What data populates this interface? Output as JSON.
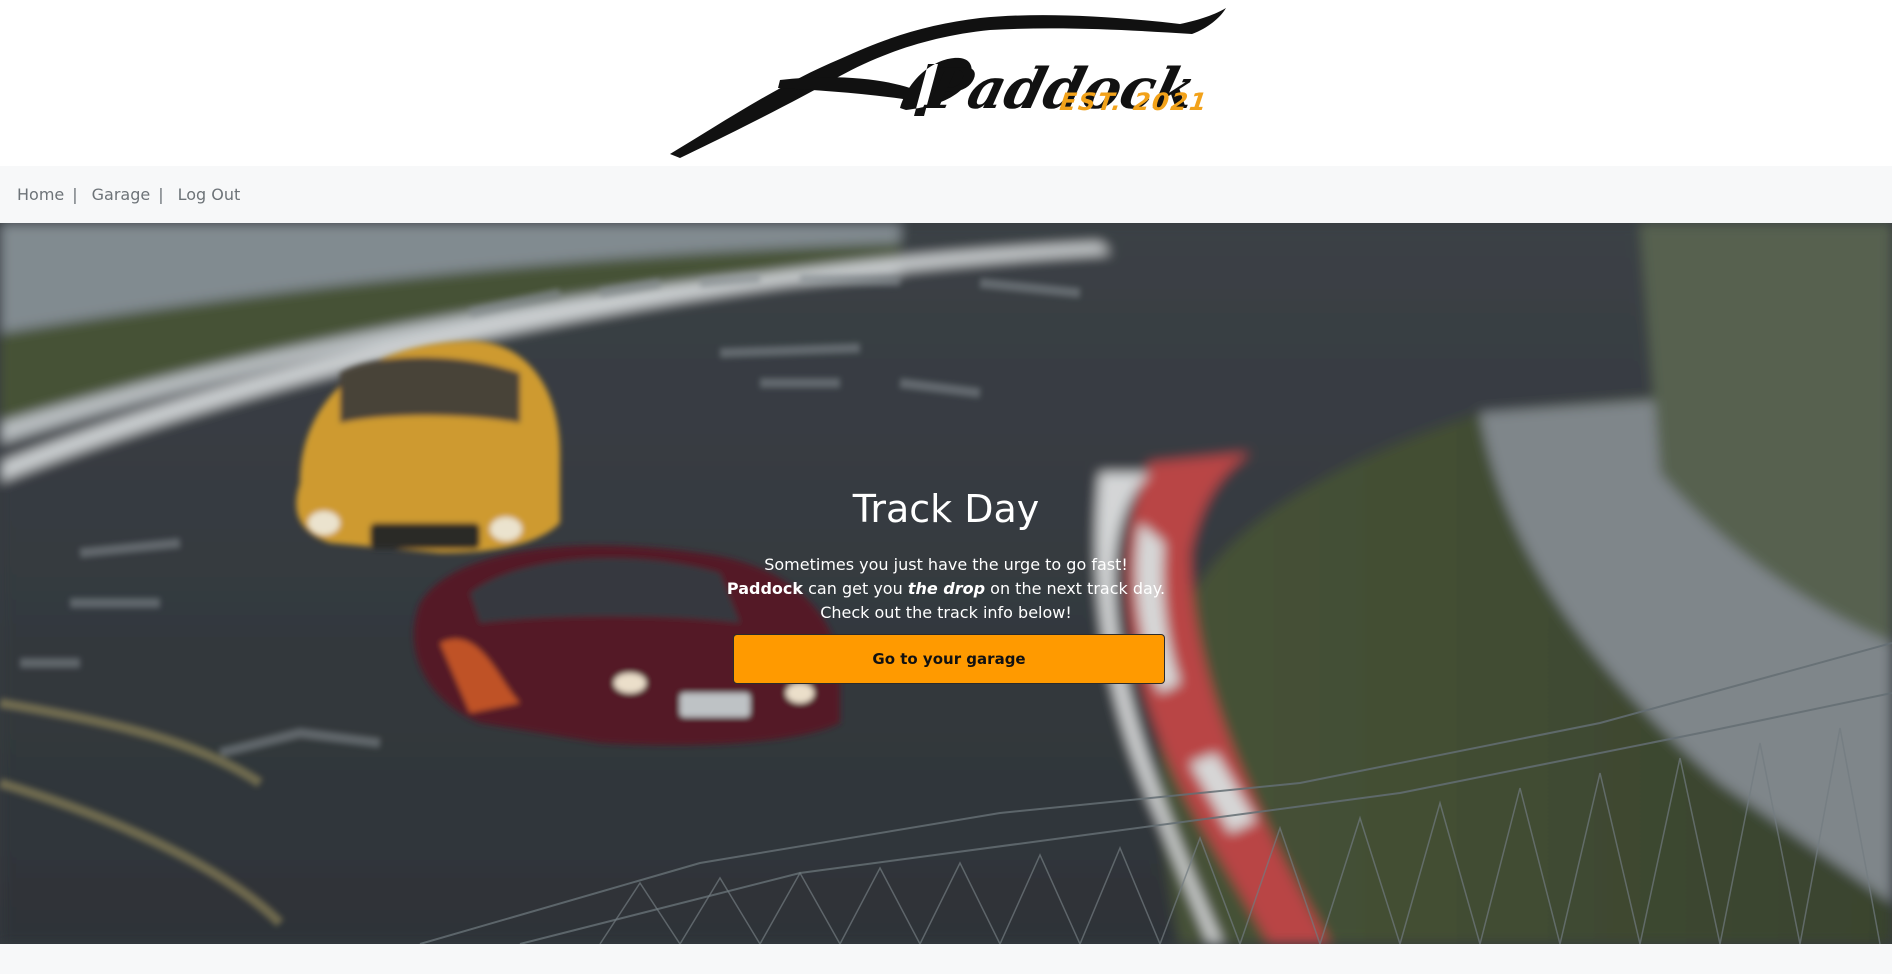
{
  "brand": {
    "logo_text": "Paddock",
    "logo_tagline": "EST. 2021",
    "accent_color": "#f2a21a"
  },
  "nav": {
    "items": [
      {
        "label": "Home",
        "separator": "|"
      },
      {
        "label": "Garage",
        "separator": "|"
      },
      {
        "label": "Log Out",
        "separator": ""
      }
    ]
  },
  "hero": {
    "background_image": "race-cars-on-track",
    "title": "Track Day",
    "line1": "Sometimes you just have the urge to go fast!",
    "line2_brand": "Paddock",
    "line2_mid": " can get you ",
    "line2_emph": "the drop",
    "line2_end": " on the next track day.",
    "line3": "Check out the track info below!",
    "button_label": "Go to your garage",
    "button_color": "#ff9a00"
  }
}
